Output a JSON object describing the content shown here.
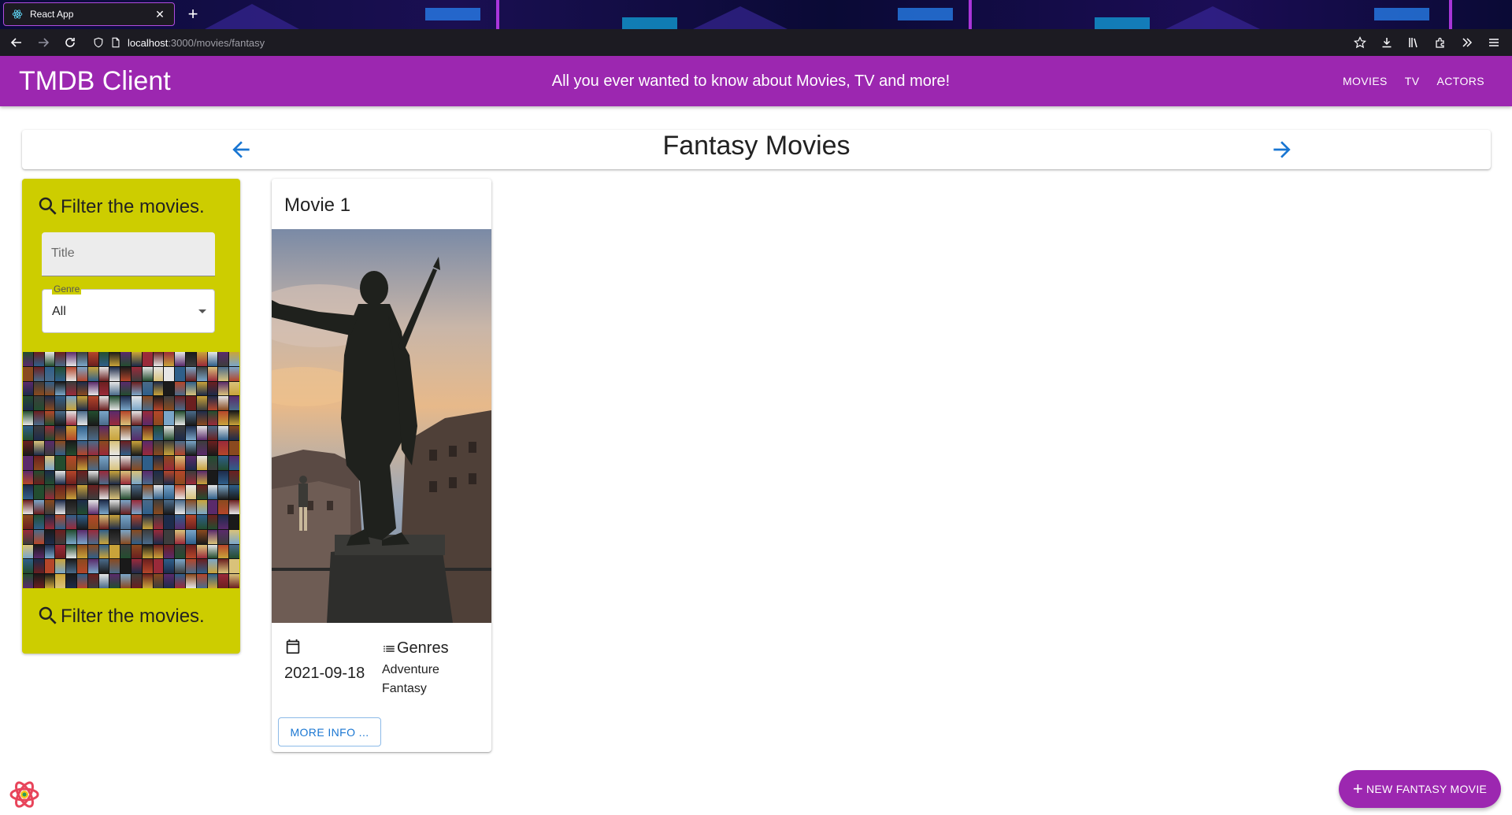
{
  "browser": {
    "tab_title": "React App",
    "url_host": "localhost",
    "url_path": ":3000/movies/fantasy"
  },
  "appbar": {
    "brand": "TMDB Client",
    "tagline": "All you ever wanted to know about Movies, TV and more!",
    "menu": [
      "MOVIES",
      "TV",
      "ACTORS"
    ]
  },
  "page": {
    "title": "Fantasy Movies"
  },
  "filter": {
    "heading": "Filter the movies.",
    "title_placeholder": "Title",
    "genre_label": "Genre",
    "genre_value": "All",
    "bottom_heading": "Filter the movies."
  },
  "movie": {
    "title": "Movie 1",
    "release_date": "2021-09-18",
    "genres_heading": "Genres",
    "genres": [
      "Adventure",
      "Fantasy"
    ],
    "more_info": "MORE INFO ..."
  },
  "fab": {
    "label": "NEW FANTASY MOVIE"
  },
  "colors": {
    "appbar": "#9c27b0",
    "filter_card": "#cdcd00",
    "link_blue": "#1976d2"
  }
}
